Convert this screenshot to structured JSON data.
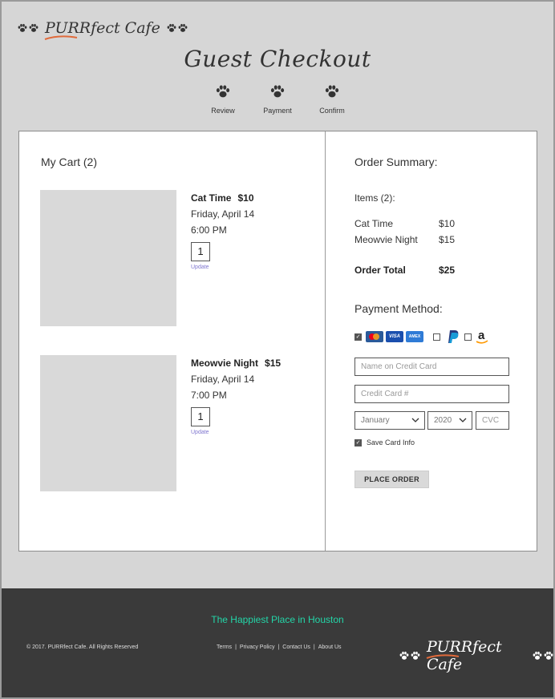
{
  "brand": {
    "name": "PURRfect Cafe"
  },
  "page": {
    "title": "Guest Checkout"
  },
  "steps": [
    {
      "label": "Review"
    },
    {
      "label": "Payment"
    },
    {
      "label": "Confirm"
    }
  ],
  "cart": {
    "title": "My Cart (2)",
    "items": [
      {
        "name": "Cat Time",
        "price": "$10",
        "date": "Friday, April 14",
        "time": "6:00 PM",
        "quantity": "1",
        "update_label": "Update"
      },
      {
        "name": "Meowvie Night",
        "price": "$15",
        "date": "Friday, April 14",
        "time": "7:00 PM",
        "quantity": "1",
        "update_label": "Update"
      }
    ]
  },
  "summary": {
    "title": "Order Summary:",
    "items_label": "Items (2):",
    "lines": [
      {
        "name": "Cat Time",
        "price": "$10"
      },
      {
        "name": "Meowvie Night",
        "price": "$15"
      }
    ],
    "total_label": "Order Total",
    "total_value": "$25"
  },
  "payment": {
    "title": "Payment Method:",
    "card_checked": true,
    "paypal_checked": false,
    "amazon_checked": false,
    "card_brands": [
      "mastercard-icon",
      "visa-icon",
      "amex-icon"
    ],
    "visa_text": "VISA",
    "amex_text": "AMEX",
    "name_placeholder": "Name on Credit Card",
    "card_placeholder": "Credit Card #",
    "month_value": "January",
    "year_value": "2020",
    "cvc_placeholder": "CVC",
    "save_label": "Save Card Info",
    "save_checked": true,
    "place_order_label": "PLACE ORDER"
  },
  "footer": {
    "tagline": "The Happiest Place in Houston",
    "copyright": "© 2017. PURRfect Cafe. All Rights Reserved",
    "links": [
      "Terms",
      "Privacy Policy",
      "Contact Us",
      "About Us"
    ]
  },
  "colors": {
    "tagline": "#23d6a8",
    "update_link": "#7f76cf",
    "footer_bg": "#3a3a3a",
    "page_bg": "#d6d6d6"
  }
}
